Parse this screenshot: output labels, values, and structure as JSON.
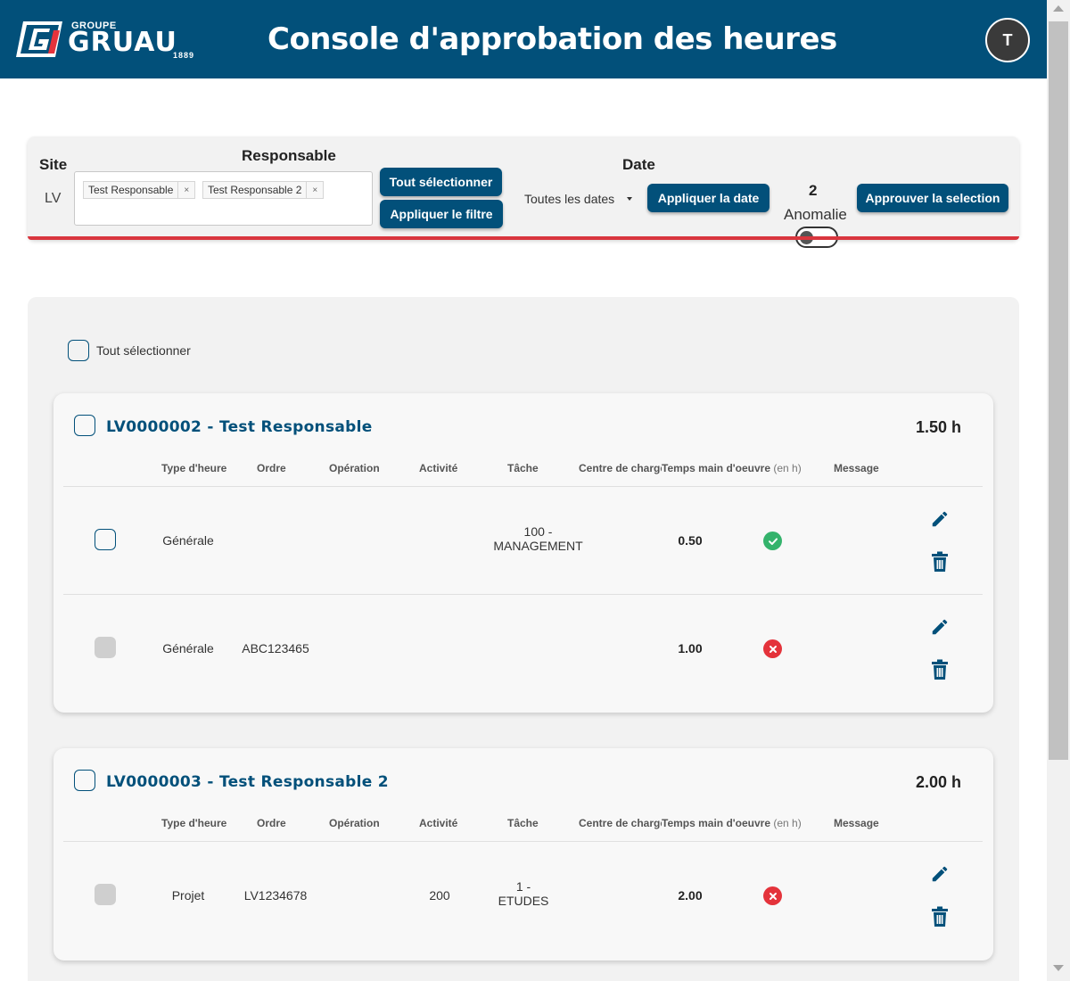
{
  "header": {
    "logo_groupe": "GROUPE",
    "logo_name": "GRUAU",
    "logo_year": "1889",
    "title": "Console d'approbation des heures",
    "avatar_initial": "T"
  },
  "filters": {
    "site_label": "Site",
    "site_value": "LV",
    "responsable_label": "Responsable",
    "responsable_chips": [
      "Test Responsable",
      "Test Responsable 2"
    ],
    "chip_remove": "×",
    "select_all_button": "Tout sélectionner",
    "apply_filter_button": "Appliquer le filtre",
    "date_label": "Date",
    "date_dropdown_value": "Toutes les dates",
    "apply_date_button": "Appliquer la date",
    "anomaly_count": "2",
    "anomaly_label": "Anomalie",
    "approve_button": "Approuver la selection"
  },
  "list": {
    "select_all_label": "Tout sélectionner",
    "columns": {
      "type": "Type d'heure",
      "ordre": "Ordre",
      "operation": "Opération",
      "activite": "Activité",
      "tache": "Tâche",
      "centre": "Centre de charge",
      "temps": "Temps main d'oeuvre",
      "temps_unit": "(en h)",
      "message": "Message"
    },
    "cards": [
      {
        "title": "LV0000002 - Test Responsable",
        "total": "1.50 h",
        "rows": [
          {
            "type": "Générale",
            "ordre": "",
            "operation": "",
            "activite": "",
            "tache_line1": "100 -",
            "tache_line2": "MANAGEMENT",
            "centre": "",
            "temps": "0.50",
            "status": "ok",
            "checkbox_enabled": true
          },
          {
            "type": "Générale",
            "ordre": "ABC123465",
            "operation": "",
            "activite": "",
            "tache_line1": "",
            "tache_line2": "",
            "centre": "",
            "temps": "1.00",
            "status": "error",
            "checkbox_enabled": false
          }
        ]
      },
      {
        "title": "LV0000003 - Test Responsable 2",
        "total": "2.00 h",
        "rows": [
          {
            "type": "Projet",
            "ordre": "LV1234678",
            "operation": "",
            "activite": "200",
            "tache_line1": "1 -",
            "tache_line2": "ETUDES",
            "centre": "",
            "temps": "2.00",
            "status": "error",
            "checkbox_enabled": false
          }
        ]
      }
    ]
  },
  "colors": {
    "brand": "#02507a",
    "ok": "#34b36c",
    "error": "#e4333b",
    "accent_line": "#d9363e"
  }
}
